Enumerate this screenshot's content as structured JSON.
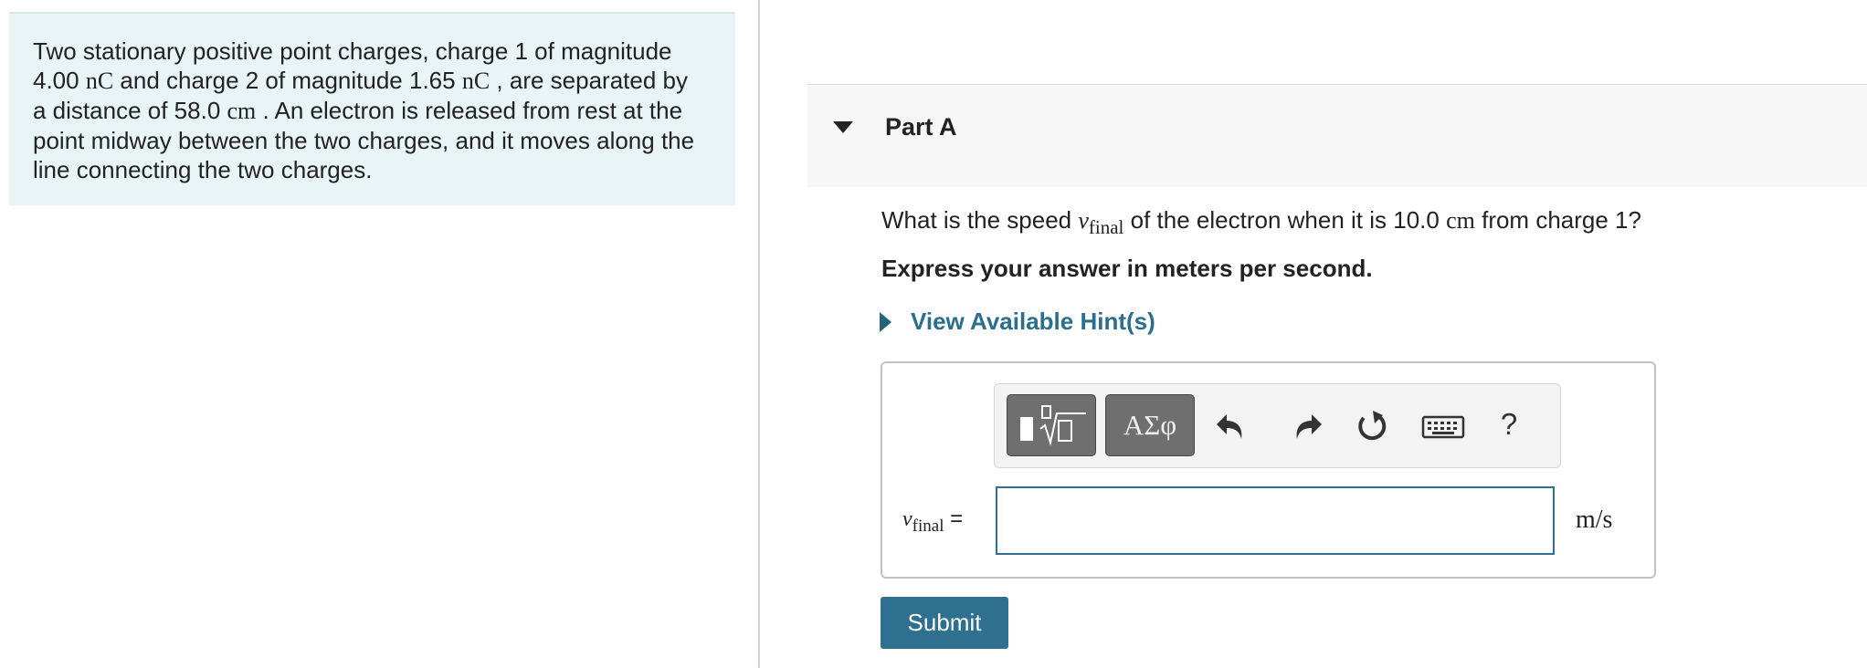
{
  "problem": {
    "t1": "Two stationary positive point charges, charge 1 of magnitude",
    "q1": "4.00",
    "q_unit": "nC",
    "t2": "and charge 2 of magnitude",
    "q2": "1.65",
    "t3": ", are separated by",
    "t4": "a distance of",
    "d": "58.0",
    "d_unit": "cm",
    "t5": ". An electron is released from rest at the",
    "t6": "point midway between the two charges, and it moves along the",
    "t7": "line connecting the two charges."
  },
  "part": {
    "title": "Part A"
  },
  "question": {
    "pre": "What is the speed",
    "var": "v",
    "var_sub": "final",
    "mid": "of the electron when it is",
    "dist": "10.0",
    "dist_unit": "cm",
    "post": "from charge 1?"
  },
  "instruction": "Express your answer in meters per second.",
  "hint": {
    "label": "View Available Hint(s)"
  },
  "toolbar": {
    "greek_label": "ΑΣφ",
    "help_label": "?",
    "icons": [
      "template-icon",
      "greek-symbols-icon",
      "undo-icon",
      "redo-icon",
      "reset-icon",
      "keyboard-icon",
      "help-icon"
    ]
  },
  "answer": {
    "var": "v",
    "var_sub": "final",
    "equals": "=",
    "value": "",
    "unit": "m/s"
  },
  "submit_label": "Submit",
  "colors": {
    "accent": "#2f6f8f",
    "problem_bg": "#e8f4f6",
    "link": "#2a6f8d"
  }
}
